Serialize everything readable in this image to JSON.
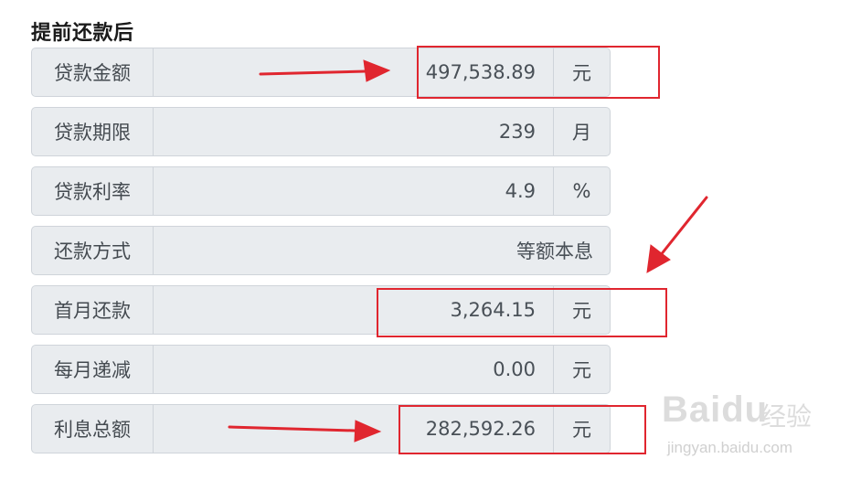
{
  "section_title": "提前还款后",
  "rows": [
    {
      "label": "贷款金额",
      "value": "497,538.89",
      "unit": "元"
    },
    {
      "label": "贷款期限",
      "value": "239",
      "unit": "月"
    },
    {
      "label": "贷款利率",
      "value": "4.9",
      "unit": "%"
    },
    {
      "label": "还款方式",
      "value": "等额本息",
      "unit": ""
    },
    {
      "label": "首月还款",
      "value": "3,264.15",
      "unit": "元"
    },
    {
      "label": "每月递减",
      "value": "0.00",
      "unit": "元"
    },
    {
      "label": "利息总额",
      "value": "282,592.26",
      "unit": "元"
    }
  ],
  "annotation_color": "#e0262f",
  "watermark": {
    "brand": "Baidu",
    "brand_cn": "经验",
    "url": "jingyan.baidu.com"
  }
}
